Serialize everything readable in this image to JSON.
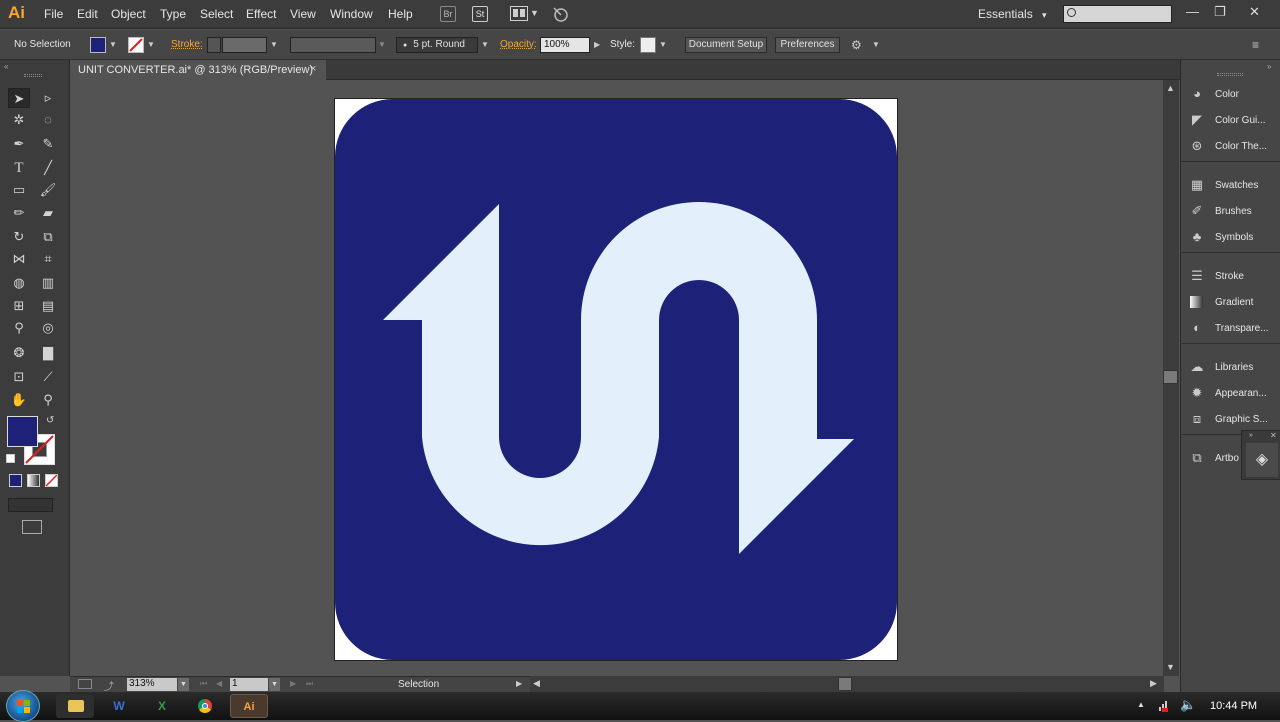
{
  "app": {
    "logo": "Ai"
  },
  "menu": [
    "File",
    "Edit",
    "Object",
    "Type",
    "Select",
    "Effect",
    "View",
    "Window",
    "Help"
  ],
  "menubar_icons": {
    "bridge": "Br",
    "stock": "St"
  },
  "workspace": {
    "label": "Essentials",
    "chevron": "▾"
  },
  "search": {
    "value": "",
    "placeholder": ""
  },
  "window_controls": {
    "minimize": "—",
    "restore": "❐",
    "close": "✕"
  },
  "control_bar": {
    "selection_status": "No Selection",
    "stroke_label": "Stroke:",
    "brush_value": "5 pt. Round",
    "opacity_label": "Opacity:",
    "opacity_value": "100%",
    "style_label": "Style:",
    "document_setup": "Document Setup",
    "preferences": "Preferences",
    "fill_color": "#1d2278"
  },
  "document": {
    "tab_title": "UNIT CONVERTER.ai* @ 313% (RGB/Preview)",
    "tab_close": "×"
  },
  "artwork": {
    "background_color": "#1d2278",
    "symbol_color": "#e3f0fb",
    "artboard_color": "#ffffff"
  },
  "status_bar": {
    "zoom": "313%",
    "artboard_number": "1",
    "tool_name": "Selection"
  },
  "panels": [
    {
      "label": "Color",
      "icon": "color-icon"
    },
    {
      "label": "Color Gui...",
      "icon": "color-guide-icon"
    },
    {
      "label": "Color The...",
      "icon": "color-themes-icon"
    },
    {
      "label": "Swatches",
      "icon": "swatches-icon"
    },
    {
      "label": "Brushes",
      "icon": "brushes-icon"
    },
    {
      "label": "Symbols",
      "icon": "symbols-icon"
    },
    {
      "label": "Stroke",
      "icon": "stroke-icon"
    },
    {
      "label": "Gradient",
      "icon": "gradient-icon"
    },
    {
      "label": "Transpare...",
      "icon": "transparency-icon"
    },
    {
      "label": "Libraries",
      "icon": "libraries-icon"
    },
    {
      "label": "Appearan...",
      "icon": "appearance-icon"
    },
    {
      "label": "Graphic S...",
      "icon": "graphic-styles-icon"
    },
    {
      "label": "Artbo",
      "icon": "artboards-icon"
    }
  ],
  "taskbar": {
    "clock": "10:44 PM",
    "apps": {
      "word": "W",
      "excel": "X",
      "illustrator": "Ai"
    }
  }
}
